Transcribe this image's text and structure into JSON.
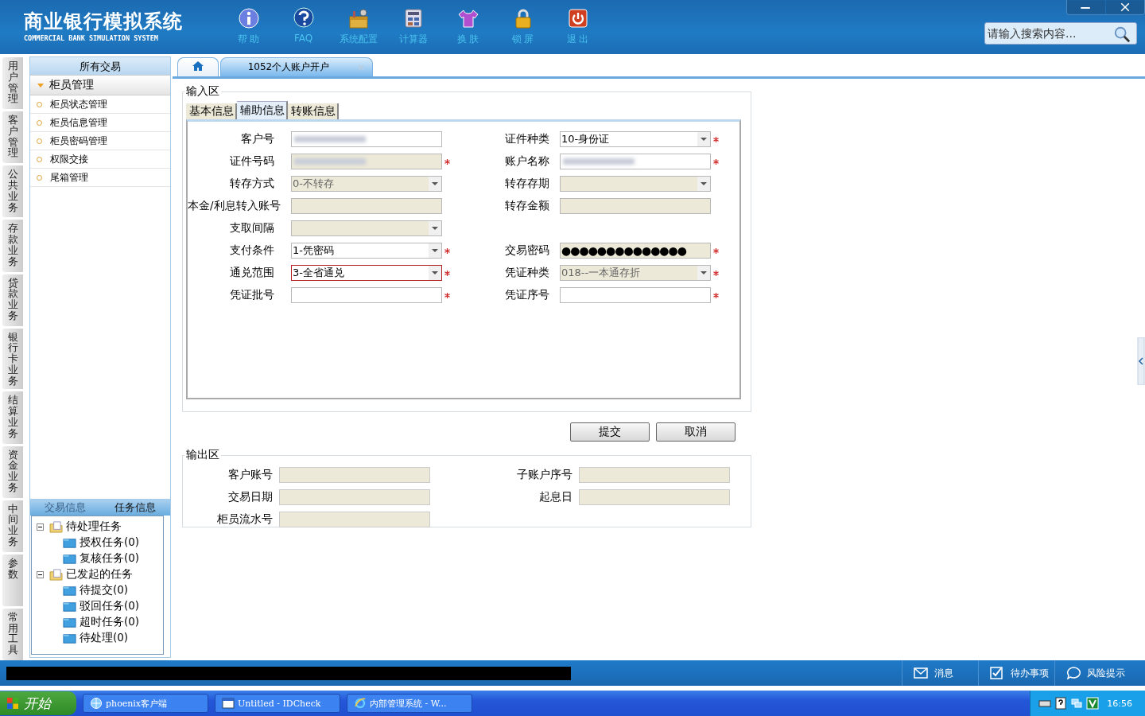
{
  "header": {
    "title": "商业银行模拟系统",
    "subtitle": "COMMERCIAL BANK SIMULATION SYSTEM",
    "tools": [
      {
        "kind": "info",
        "label": "帮 助"
      },
      {
        "kind": "faq",
        "label": "FAQ"
      },
      {
        "kind": "toolbox",
        "label": "系统配置"
      },
      {
        "kind": "calculator",
        "label": "计算器"
      },
      {
        "kind": "shirt",
        "label": "换 肤"
      },
      {
        "kind": "lock",
        "label": "锁 屏"
      },
      {
        "kind": "power",
        "label": "退 出"
      }
    ],
    "search": {
      "placeholder": "请输入搜索内容..."
    }
  },
  "left_tabs": [
    {
      "label": "用户管理"
    },
    {
      "label": "客户管理"
    },
    {
      "label": "公共业务"
    },
    {
      "label": "存款业务"
    },
    {
      "label": "贷款业务"
    },
    {
      "label": "银行卡业务"
    },
    {
      "label": "结算业务"
    },
    {
      "label": "资金业务"
    },
    {
      "label": "中间业务"
    },
    {
      "label": "参数"
    },
    {
      "label": "常用工具"
    }
  ],
  "sidebar": {
    "title": "所有交易",
    "group": {
      "label": "柜员管理",
      "expanded": true
    },
    "items": [
      "柜员状态管理",
      "柜员信息管理",
      "柜员密码管理",
      "权限交接",
      "尾箱管理"
    ]
  },
  "task_panel": {
    "tabs": [
      {
        "label": "交易信息",
        "selected": false
      },
      {
        "label": "任务信息",
        "selected": true
      }
    ],
    "tree": [
      {
        "label": "待处理任务",
        "expanded": true,
        "children": [
          {
            "label": "授权任务(0)"
          },
          {
            "label": "复核任务(0)"
          }
        ]
      },
      {
        "label": "已发起的任务",
        "expanded": true,
        "children": [
          {
            "label": "待提交(0)"
          },
          {
            "label": "驳回任务(0)"
          },
          {
            "label": "超时任务(0)"
          },
          {
            "label": "待处理(0)"
          }
        ]
      }
    ]
  },
  "doc_tabs": [
    {
      "kind": "home",
      "selected": false
    },
    {
      "kind": "doc",
      "label": "1052个人账户开户",
      "selected": true
    }
  ],
  "input_area": {
    "title": "输入区",
    "tabs": [
      {
        "label": "基本信息",
        "selected": false
      },
      {
        "label": "辅助信息",
        "selected": true
      },
      {
        "label": "转账信息",
        "selected": false
      }
    ],
    "rows": [
      [
        {
          "label": "客户号",
          "kind": "text",
          "redacted": true,
          "disabled": false,
          "required": false,
          "error": false
        },
        {
          "label": "证件种类",
          "kind": "select",
          "value": "10-身份证",
          "disabled": false,
          "required": true,
          "error": false
        }
      ],
      [
        {
          "label": "证件号码",
          "kind": "text",
          "redacted": true,
          "disabled": true,
          "required": true,
          "error": false
        },
        {
          "label": "账户名称",
          "kind": "text",
          "redacted": true,
          "disabled": false,
          "required": true,
          "error": false
        }
      ],
      [
        {
          "label": "转存方式",
          "kind": "select",
          "value": "0-不转存",
          "disabled": true,
          "required": false,
          "error": false
        },
        {
          "label": "转存存期",
          "kind": "select",
          "disabled": true,
          "required": false,
          "error": false
        }
      ],
      [
        {
          "label": "本金/利息转入账号",
          "kind": "text",
          "disabled": true,
          "required": false,
          "error": false
        },
        {
          "label": "转存金额",
          "kind": "text",
          "disabled": true,
          "required": false,
          "error": false
        }
      ],
      [
        {
          "label": "支取间隔",
          "kind": "select",
          "disabled": true,
          "required": false,
          "error": false
        }
      ],
      [
        {
          "label": "支付条件",
          "kind": "select",
          "value": "1-凭密码",
          "disabled": false,
          "required": true,
          "error": false
        },
        {
          "label": "交易密码",
          "kind": "password",
          "value": "●●●●●●●●●●●●●●",
          "disabled": true,
          "required": true,
          "error": false
        }
      ],
      [
        {
          "label": "通兑范围",
          "kind": "select",
          "value": "3-全省通兑",
          "disabled": false,
          "required": true,
          "error": true
        },
        {
          "label": "凭证种类",
          "kind": "select",
          "value": "018--一本通存折",
          "disabled": true,
          "required": true,
          "error": false
        }
      ],
      [
        {
          "label": "凭证批号",
          "kind": "text",
          "disabled": false,
          "required": true,
          "error": false
        },
        {
          "label": "凭证序号",
          "kind": "text",
          "disabled": false,
          "required": true,
          "error": false
        }
      ]
    ]
  },
  "buttons": [
    "提交",
    "取消"
  ],
  "output_area": {
    "title": "输出区",
    "rows": [
      [
        {
          "label": "客户账号"
        },
        {
          "label": "子账户序号"
        }
      ],
      [
        {
          "label": "交易日期"
        },
        {
          "label": "起息日"
        }
      ],
      [
        {
          "label": "柜员流水号"
        }
      ]
    ]
  },
  "status_bar": {
    "items": [
      {
        "kind": "mail",
        "label": "消息"
      },
      {
        "kind": "check",
        "label": "待办事项"
      },
      {
        "kind": "bubble",
        "label": "风险提示"
      }
    ]
  },
  "taskbar": {
    "start": "开始",
    "tasks": [
      {
        "kind": "globe",
        "label": "phoenix客户端"
      },
      {
        "kind": "window",
        "label": "Untitled - IDCheck"
      },
      {
        "kind": "ie",
        "label": "内部管理系统 - W..."
      }
    ],
    "clock": "16:56"
  }
}
